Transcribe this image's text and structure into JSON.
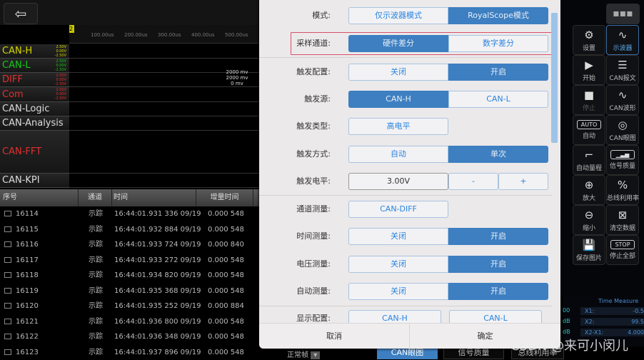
{
  "scope": {
    "back_icon": "arrow-left-icon",
    "marker": "2",
    "ticks": [
      "100.00us",
      "200.00us",
      "300.00us",
      "400.00us",
      "500.00us"
    ],
    "channels": [
      {
        "name": "CAN-H",
        "color": "#d6d600",
        "volts": [
          "2.50V",
          "0.00V",
          "-2.50V"
        ]
      },
      {
        "name": "CAN-L",
        "color": "#19c819",
        "volts": [
          "2.50V",
          "0.00V",
          "-2.50V"
        ]
      },
      {
        "name": "DIFF",
        "color": "#e03030",
        "volts": [
          "2.50V",
          "0.00V",
          "-2.50V"
        ]
      },
      {
        "name": "Com",
        "color": "#e03030",
        "volts": [
          "2.50V",
          "0.00V",
          "-2.50V"
        ]
      },
      {
        "name": "CAN-Logic",
        "color": "#dddddd"
      },
      {
        "name": "CAN-Analysis",
        "color": "#dddddd"
      },
      {
        "name": "CAN-FFT",
        "color": "#e03030"
      },
      {
        "name": "CAN-KPI",
        "color": "#dddddd"
      }
    ],
    "mv_labels": [
      "2000 mv",
      "2000 mv",
      "0 mv"
    ]
  },
  "table": {
    "headers": [
      "序号",
      "通道",
      "时间",
      "增量时间"
    ],
    "rows": [
      [
        "16114",
        "示踪",
        "16:44:01.931 336 09/19",
        "0.000 548"
      ],
      [
        "16115",
        "示踪",
        "16:44:01.932 884 09/19",
        "0.000 548"
      ],
      [
        "16116",
        "示踪",
        "16:44:01.933 724 09/19",
        "0.000 840"
      ],
      [
        "16117",
        "示踪",
        "16:44:01.933 272 09/19",
        "0.000 548"
      ],
      [
        "16118",
        "示踪",
        "16:44:01.934 820 09/19",
        "0.000 548"
      ],
      [
        "16119",
        "示踪",
        "16:44:01.935 368 09/19",
        "0.000 548"
      ],
      [
        "16120",
        "示踪",
        "16:44:01.935 252 09/19",
        "0.000 884"
      ],
      [
        "16121",
        "示踪",
        "16:44:01.936 800 09/19",
        "0.000 548"
      ],
      [
        "16122",
        "示踪",
        "16:44:01.936 348 09/19",
        "0.000 548"
      ],
      [
        "16123",
        "示踪",
        "16:44:01.937 896 09/19",
        "0.000 548"
      ]
    ],
    "frame_filter": "正常帧"
  },
  "dialog": {
    "mode": {
      "label": "模式:",
      "options": [
        "仅示波器模式",
        "RoyalScope模式"
      ],
      "selected": 1
    },
    "sampling": {
      "label": "采样通道:",
      "options": [
        "硬件差分",
        "数字差分"
      ],
      "selected": 0
    },
    "trigger_config": {
      "label": "触发配置:",
      "options": [
        "关闭",
        "开启"
      ],
      "selected": 1
    },
    "trigger_source": {
      "label": "触发源:",
      "options": [
        "CAN-H",
        "CAN-L"
      ],
      "selected": 0
    },
    "trigger_type": {
      "label": "触发类型:",
      "value": "高电平"
    },
    "trigger_mode": {
      "label": "触发方式:",
      "options": [
        "自动",
        "单次"
      ],
      "selected": 1
    },
    "trigger_level": {
      "label": "触发电平:",
      "value": "3.00V",
      "minus": "-",
      "plus": "+"
    },
    "channel_measure": {
      "label": "通道测量:",
      "value": "CAN-DIFF"
    },
    "time_measure": {
      "label": "时间测量:",
      "options": [
        "关闭",
        "开启"
      ],
      "selected": 1
    },
    "voltage_measure": {
      "label": "电压测量:",
      "options": [
        "关闭",
        "开启"
      ],
      "selected": 1
    },
    "auto_measure": {
      "label": "自动测量:",
      "options": [
        "关闭",
        "开启"
      ],
      "selected": 1
    },
    "display_config": {
      "label": "显示配置:",
      "options": [
        "CAN-H",
        "CAN-L"
      ]
    },
    "cancel": "取消",
    "confirm": "确定"
  },
  "side": {
    "menu_icon": "grid-menu-icon",
    "tiles": [
      {
        "label": "设置",
        "icon": "gear-icon",
        "glyph": "⚙"
      },
      {
        "label": "示波器",
        "icon": "oscilloscope-icon",
        "glyph": "∿",
        "active": true
      },
      {
        "label": "开始",
        "icon": "play-icon",
        "glyph": "▶"
      },
      {
        "label": "CAN报文",
        "icon": "document-icon",
        "glyph": "☰"
      },
      {
        "label": "停止",
        "icon": "stop-icon",
        "glyph": "■",
        "disabled": true
      },
      {
        "label": "CAN波形",
        "icon": "waveform-icon",
        "glyph": "∿"
      },
      {
        "label": "自动",
        "icon": "auto-icon",
        "glyph": "AUTO"
      },
      {
        "label": "CAN眼图",
        "icon": "eye-diagram-icon",
        "glyph": "◎"
      },
      {
        "label": "自动量程",
        "icon": "ruler-icon",
        "glyph": "⌐"
      },
      {
        "label": "信号质量",
        "icon": "signal-bars-icon",
        "glyph": "▁▃▅"
      },
      {
        "label": "放大",
        "icon": "zoom-in-icon",
        "glyph": "⊕"
      },
      {
        "label": "总线利用率",
        "icon": "bus-usage-icon",
        "glyph": "%"
      },
      {
        "label": "缩小",
        "icon": "zoom-out-icon",
        "glyph": "⊖"
      },
      {
        "label": "清空数据",
        "icon": "clear-data-icon",
        "glyph": "⊠"
      },
      {
        "label": "保存图片",
        "icon": "save-icon",
        "glyph": "💾"
      },
      {
        "label": "停止全部",
        "icon": "stop-all-icon",
        "glyph": "STOP"
      }
    ]
  },
  "bottom_tabs": [
    "CAN眼图",
    "信号质量",
    "总线利用率"
  ],
  "time_measure": {
    "title": "Time Measure",
    "rows": [
      [
        "X1:",
        "-0.5"
      ],
      [
        "X2:",
        "99.5"
      ],
      [
        "X2-X1:",
        "4.000"
      ]
    ],
    "left_vals": [
      "00",
      "dB",
      "dB"
    ]
  },
  "watermark": "CSDN @来可小闵儿",
  "colors": {
    "accent": "#3d7fc1",
    "highlight_border": "#d8506a"
  }
}
